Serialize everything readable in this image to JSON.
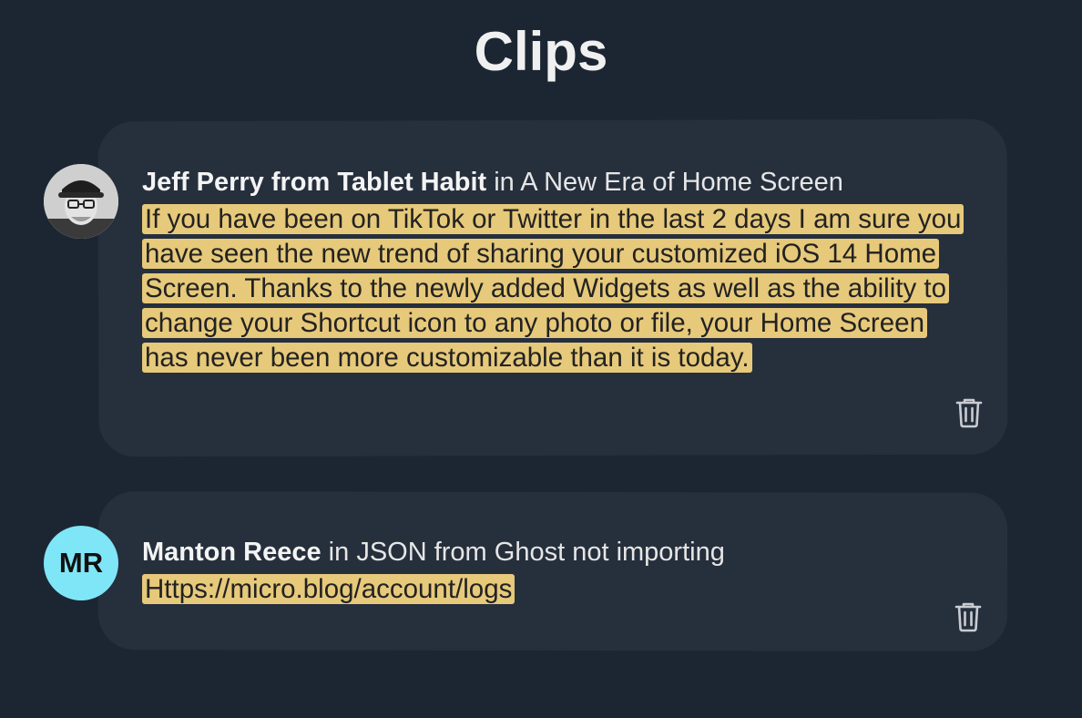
{
  "header": {
    "title": "Clips"
  },
  "clips": [
    {
      "author": "Jeff Perry from Tablet Habit",
      "connector": "in",
      "post_title": "A New Era of Home Screen",
      "quote": "If you have been on TikTok or Twitter in the last 2 days I am sure you have seen the new trend of sharing your customized iOS 14 Home Screen. Thanks to the newly added Widgets as well as the ability to change your Shortcut icon to any photo or file, your Home Screen has never been more customizable than it is today.",
      "avatar": "photo",
      "delete_icon": "trash-icon"
    },
    {
      "author": "Manton Reece",
      "connector": "in",
      "post_title": "JSON from Ghost not importing",
      "quote": "Https://micro.blog/account/logs",
      "avatar_initials": "MR",
      "avatar_color": "#7fe6f7",
      "delete_icon": "trash-icon"
    }
  ],
  "colors": {
    "background": "#1c2633",
    "card": "#262f3c",
    "highlight": "#e6c97a"
  }
}
